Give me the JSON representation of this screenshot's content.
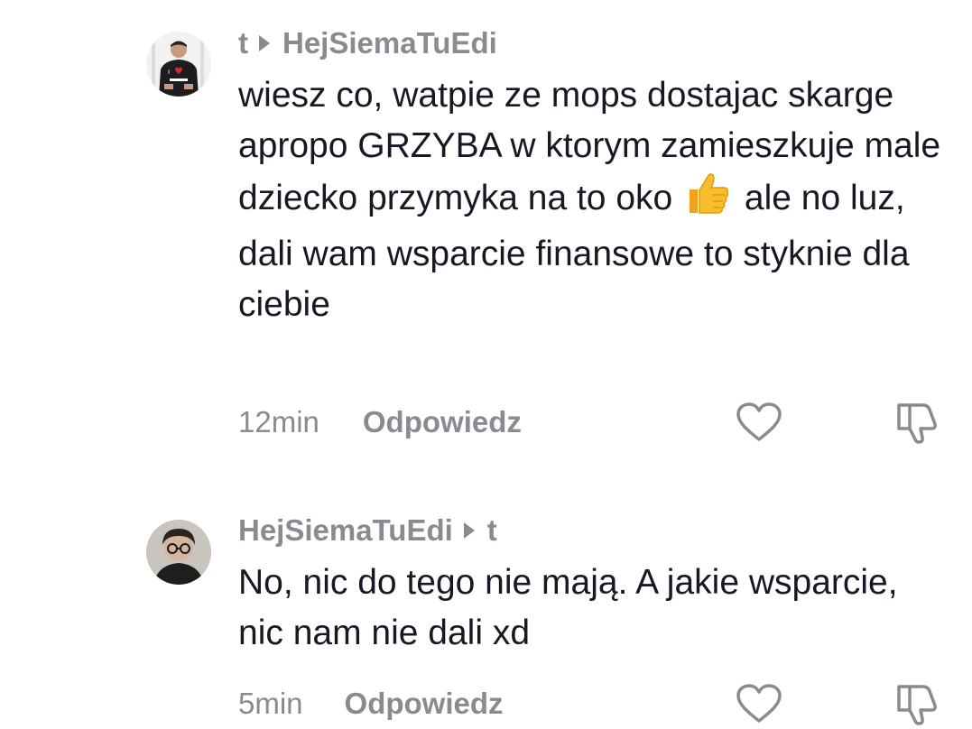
{
  "comments": [
    {
      "author": "t",
      "reply_to": "HejSiemaTuEdi",
      "text_part1": "wiesz co, watpie ze mops dostajac skarge apropo GRZYBA w ktorym zamieszkuje male dziecko przymyka na to oko",
      "emoji": "👍",
      "text_part2": "ale no luz, dali wam wsparcie finansowe to styknie dla ciebie",
      "time": "12min",
      "reply_label": "Odpowiedz",
      "avatar_icon": "avatar-man-i-love-shirt-icon"
    },
    {
      "author": "HejSiemaTuEdi",
      "reply_to": "t",
      "text": "No, nic do tego nie mają. A jakie wsparcie, nic nam nie dali xd",
      "time": "5min",
      "reply_label": "Odpowiedz",
      "avatar_icon": "avatar-person-glasses-icon"
    }
  ],
  "colors": {
    "secondary_text": "#8a8b91",
    "primary_text": "#161823",
    "background": "#ffffff"
  }
}
